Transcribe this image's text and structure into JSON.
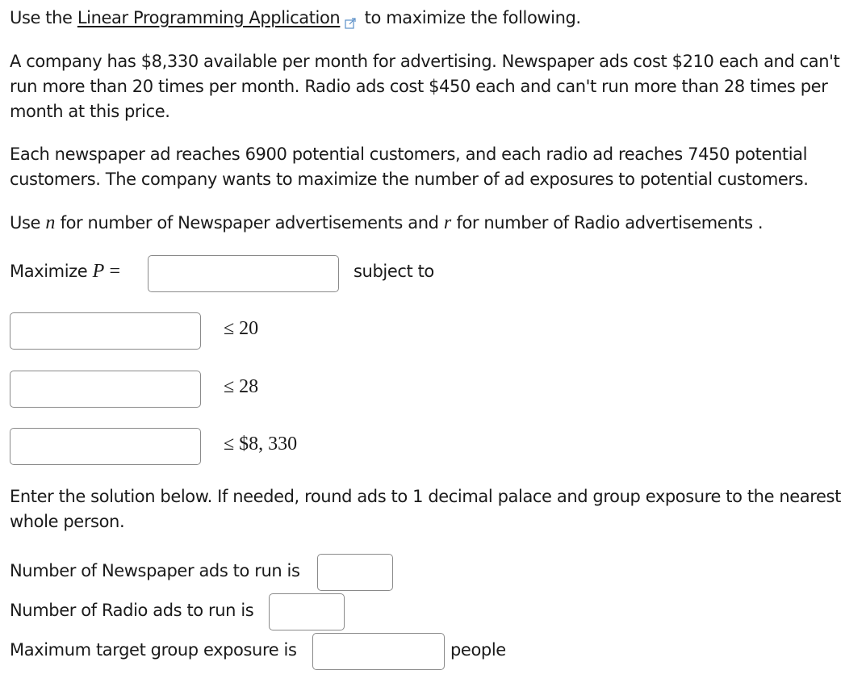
{
  "intro": {
    "prefix": "Use the ",
    "link_text": "Linear Programming Application",
    "link_icon": "external-link-icon",
    "suffix": " to maximize the following."
  },
  "problem": {
    "paragraph1": "A company has $8,330 available per month for advertising. Newspaper ads cost $210 each and can't run more than 20 times per month. Radio ads cost $450 each and can't run more than 28 times per month at this price.",
    "paragraph2": "Each newspaper ad reaches 6900 potential customers, and each radio ad reaches 7450 potential customers. The company wants to maximize the number of ad exposures to potential customers.",
    "variables": {
      "part1": "Use ",
      "var_n": "n",
      "part2": " for number of Newspaper advertisements and ",
      "var_r": "r",
      "part3": " for number of Radio advertisements ."
    }
  },
  "objective": {
    "label": "Maximize ",
    "var": "P",
    "equals": "=",
    "input_value": "",
    "subject_to": "subject to"
  },
  "constraints": [
    {
      "input_value": "",
      "relation": "≤",
      "bound": "20"
    },
    {
      "input_value": "",
      "relation": "≤",
      "bound": "28"
    },
    {
      "input_value": "",
      "relation": "≤",
      "bound": "$8, 330"
    }
  ],
  "solution": {
    "instructions": "Enter the solution below. If needed, round ads to 1 decimal palace and group exposure to the nearest whole person.",
    "newspaper_label": "Number of Newspaper ads to run is",
    "newspaper_value": "",
    "radio_label": "Number of Radio ads to run is",
    "radio_value": "",
    "exposure_label": "Maximum target group exposure is",
    "exposure_value": "",
    "exposure_unit": "people"
  }
}
